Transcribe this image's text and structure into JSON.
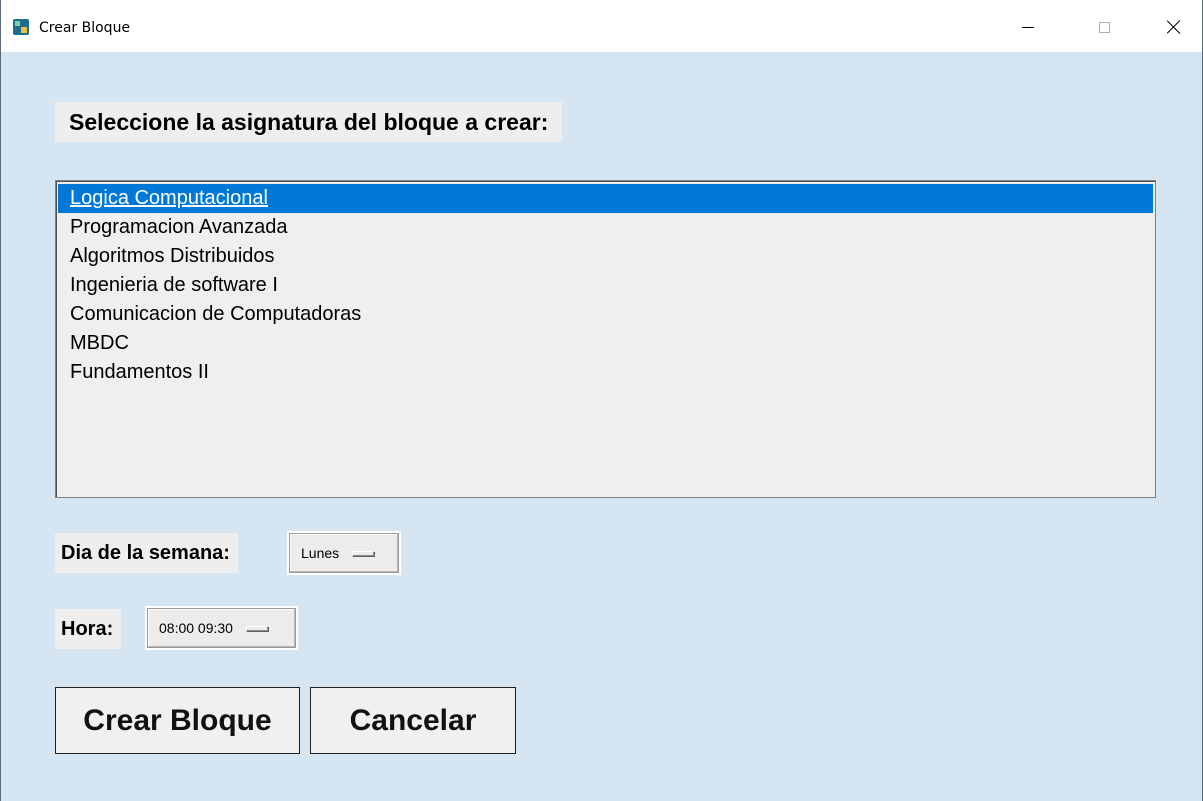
{
  "window": {
    "title": "Crear Bloque"
  },
  "prompt": {
    "label": "Seleccione la asignatura del bloque a crear:"
  },
  "subjects": {
    "selected_index": 0,
    "items": [
      "Logica Computacional",
      "Programacion Avanzada",
      "Algoritmos Distribuidos",
      "Ingenieria de software I",
      "Comunicacion de Computadoras",
      "MBDC",
      "Fundamentos II"
    ]
  },
  "day": {
    "label": "Dia de la semana:",
    "value": "Lunes"
  },
  "hour": {
    "label": "Hora:",
    "value": "08:00 09:30"
  },
  "buttons": {
    "create": "Crear Bloque",
    "cancel": "Cancelar"
  },
  "colors": {
    "window_bg": "#d5e6f2",
    "selection": "#0078d7",
    "list_bg": "#efefef"
  },
  "icons": {
    "app": "app-icon",
    "minimize": "minimize-icon",
    "maximize": "maximize-icon",
    "close": "close-icon"
  }
}
